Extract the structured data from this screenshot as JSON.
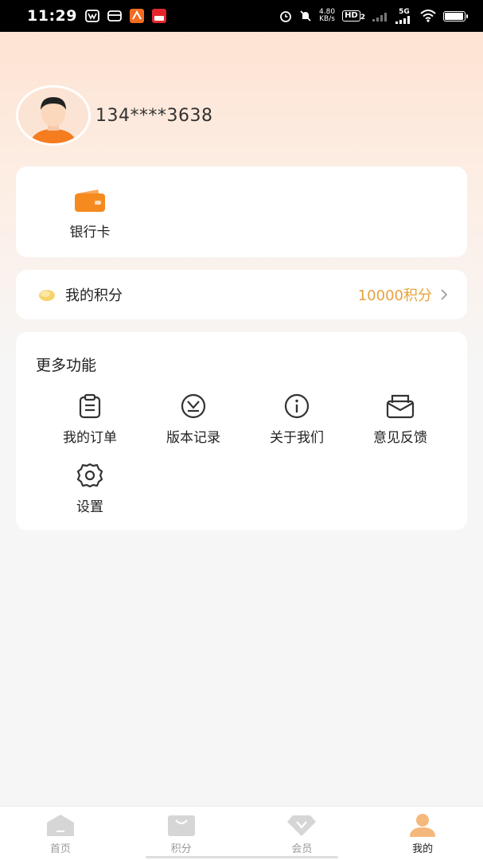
{
  "status_bar": {
    "time": "11:29",
    "speed_value": "4.80",
    "speed_unit": "KB/s",
    "hd_label": "HD",
    "hd_sub": "2",
    "network": "5G",
    "battery_level": 0.9
  },
  "profile": {
    "username": "134****3638"
  },
  "bank_card": {
    "label": "银行卡"
  },
  "points": {
    "label": "我的积分",
    "value": "10000积分"
  },
  "more": {
    "title": "更多功能",
    "items": [
      {
        "label": "我的订单",
        "icon": "clipboard-icon"
      },
      {
        "label": "版本记录",
        "icon": "version-icon"
      },
      {
        "label": "关于我们",
        "icon": "info-icon"
      },
      {
        "label": "意见反馈",
        "icon": "mail-icon"
      },
      {
        "label": "设置",
        "icon": "gear-icon"
      }
    ]
  },
  "tabbar": {
    "tabs": [
      {
        "label": "首页",
        "icon": "home-icon",
        "active": false
      },
      {
        "label": "积分",
        "icon": "bag-icon",
        "active": false
      },
      {
        "label": "会员",
        "icon": "diamond-icon",
        "active": false
      },
      {
        "label": "我的",
        "icon": "person-icon",
        "active": true
      }
    ]
  },
  "colors": {
    "accent": "#e7a23d",
    "wallet": "#f58a1f",
    "tab_active": "#f5b87c",
    "tab_inactive": "#d6d6d6"
  }
}
